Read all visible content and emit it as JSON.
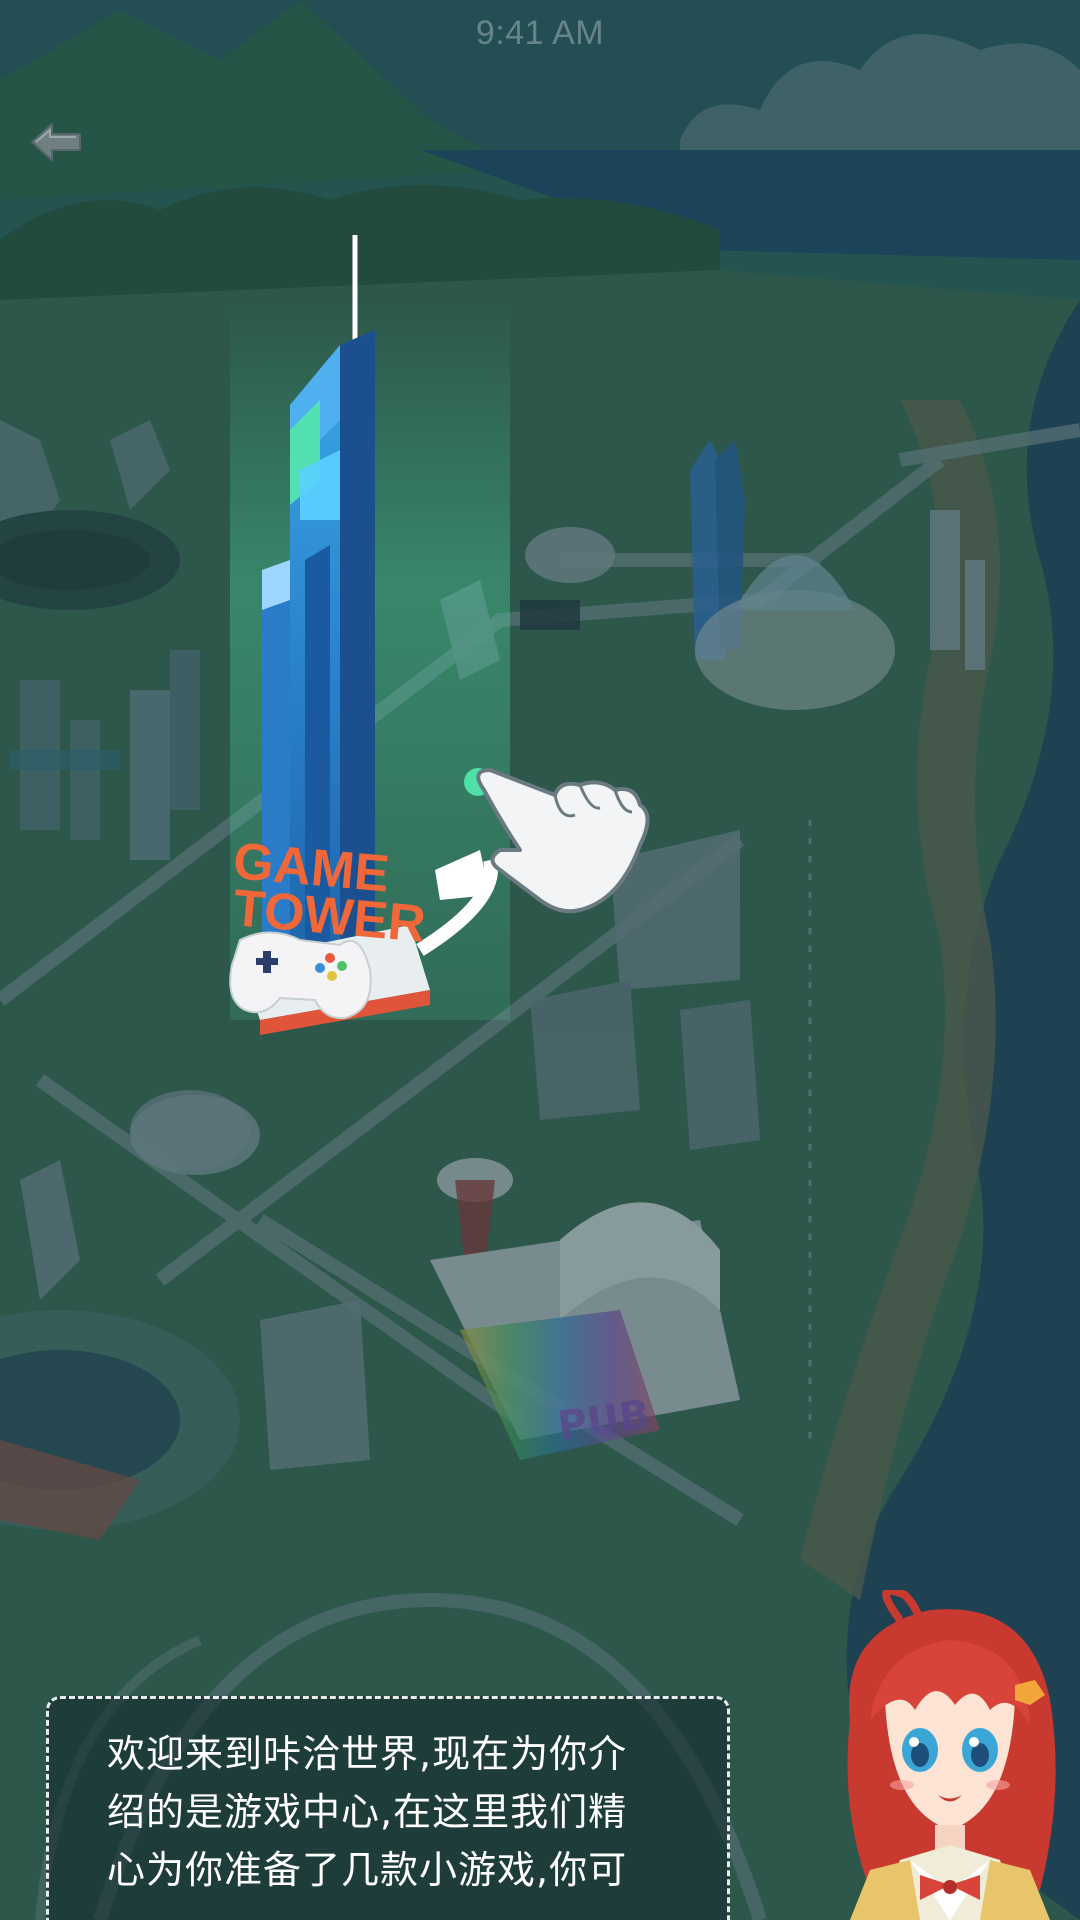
{
  "status_bar": {
    "time": "9:41 AM"
  },
  "nav": {
    "back_icon": "back-arrow-icon"
  },
  "map": {
    "game_tower_sign": [
      "GAME",
      "TOWER"
    ],
    "pub_sign": "PUB",
    "tap_hint_icon": "pointing-hand-icon",
    "colors": {
      "overlay": "#1f4a4f",
      "tower_blue": "#2f8fd6",
      "sign_orange": "#f0673a",
      "highlight_green": "#4fe0a6"
    }
  },
  "dialog": {
    "lines": [
      "欢迎来到咔洽世界,现在为你介",
      "绍的是游戏中心,在这里我们精",
      "心为你准备了几款小游戏,你可"
    ]
  },
  "guide_character": {
    "icon": "anime-guide-girl"
  }
}
